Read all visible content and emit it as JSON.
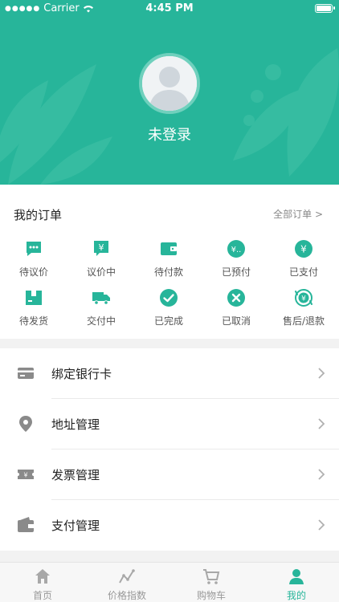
{
  "status_bar": {
    "carrier": "Carrier",
    "time": "4:45 PM"
  },
  "profile": {
    "login_text": "未登录"
  },
  "orders": {
    "title": "我的订单",
    "all_link": "全部订单 >",
    "items": [
      {
        "label": "待议价",
        "icon": "chat-bubble-icon"
      },
      {
        "label": "议价中",
        "icon": "yen-bubble-icon"
      },
      {
        "label": "待付款",
        "icon": "wallet-icon"
      },
      {
        "label": "已预付",
        "icon": "yen-coin-icon"
      },
      {
        "label": "已支付",
        "icon": "yen-coin-icon"
      },
      {
        "label": "待发货",
        "icon": "package-icon"
      },
      {
        "label": "交付中",
        "icon": "truck-icon"
      },
      {
        "label": "已完成",
        "icon": "check-circle-icon"
      },
      {
        "label": "已取消",
        "icon": "x-circle-icon"
      },
      {
        "label": "售后/退款",
        "icon": "refund-icon"
      }
    ]
  },
  "menu": [
    {
      "label": "绑定银行卡",
      "icon": "bank-card-icon"
    },
    {
      "label": "地址管理",
      "icon": "location-pin-icon"
    },
    {
      "label": "发票管理",
      "icon": "invoice-icon"
    },
    {
      "label": "支付管理",
      "icon": "wallet-icon"
    }
  ],
  "tabbar": {
    "tabs": [
      {
        "label": "首页",
        "icon": "home-icon"
      },
      {
        "label": "价格指数",
        "icon": "trend-icon"
      },
      {
        "label": "购物车",
        "icon": "cart-icon"
      },
      {
        "label": "我的",
        "icon": "user-icon",
        "active": true
      }
    ]
  },
  "colors": {
    "accent": "#27b59a",
    "icon_gray": "#8a8a8a",
    "text": "#222222"
  }
}
